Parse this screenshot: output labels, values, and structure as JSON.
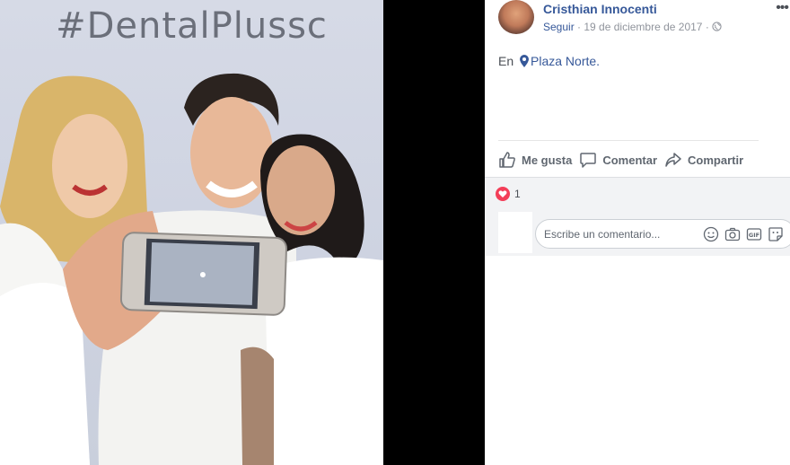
{
  "photo": {
    "hashtag": "#DentalPlussc"
  },
  "post": {
    "author": "Cristhian Innocenti",
    "follow_label": "Seguir",
    "dot": "·",
    "date": "19 de diciembre de 2017",
    "location_prefix": "En",
    "location": "Plaza Norte."
  },
  "actions": {
    "like": "Me gusta",
    "comment": "Comentar",
    "share": "Compartir"
  },
  "reactions": {
    "count": "1"
  },
  "comment_box": {
    "placeholder": "Escribe un comentario..."
  },
  "colors": {
    "link": "#365899",
    "heart": "#f33e58"
  }
}
